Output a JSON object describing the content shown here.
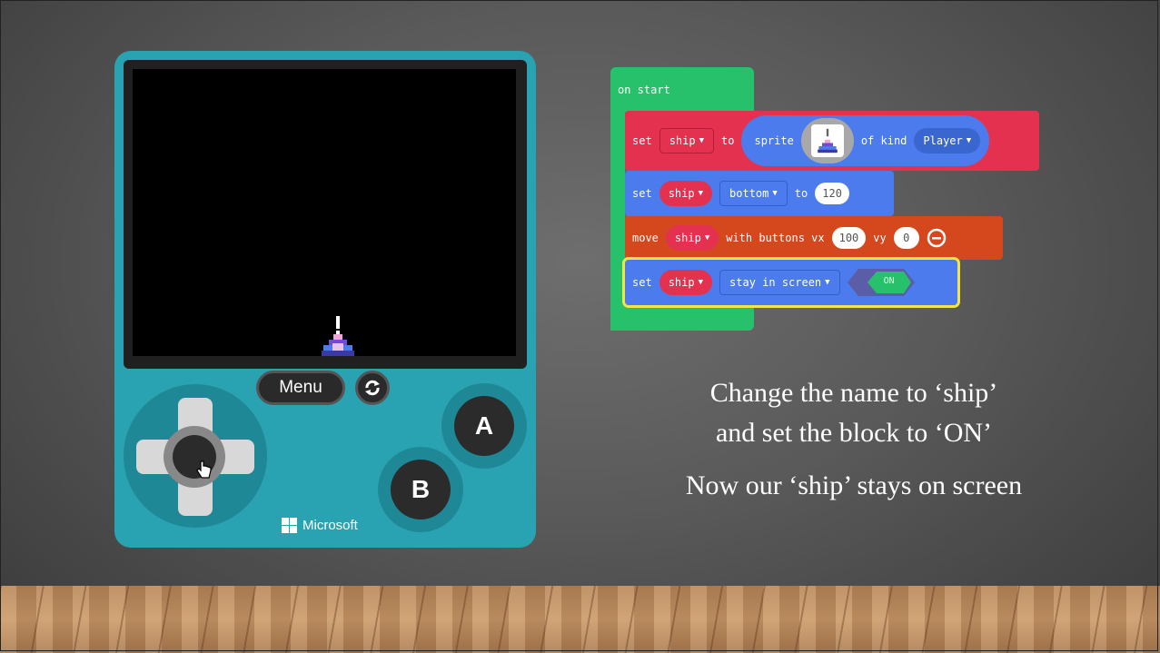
{
  "console": {
    "menu_label": "Menu",
    "button_a": "A",
    "button_b": "B",
    "brand": "Microsoft"
  },
  "blocks": {
    "on_start": "on start",
    "row1": {
      "kw_set": "set",
      "var": "ship",
      "kw_to": "to",
      "kw_sprite": "sprite",
      "kw_of_kind": "of kind",
      "kind": "Player"
    },
    "row2": {
      "kw_set": "set",
      "var": "ship",
      "prop": "bottom",
      "kw_to": "to",
      "value": "120"
    },
    "row3": {
      "kw_move": "move",
      "var": "ship",
      "kw_with": "with buttons vx",
      "vx": "100",
      "kw_vy": "vy",
      "vy": "0"
    },
    "row4": {
      "kw_set": "set",
      "var": "ship",
      "flag": "stay in screen",
      "toggle": "ON"
    }
  },
  "caption": {
    "line1": "Change the name to ‘ship’",
    "line2": "and set the block to ‘ON’",
    "line3": "Now our ‘ship’ stays on screen"
  },
  "colors": {
    "console": "#29a2b1",
    "on_start_green": "#27c06b",
    "variable_red": "#e53150",
    "sprites_blue": "#4b7bec",
    "controller_orange": "#d5481e",
    "toggle_green": "#27c06b",
    "highlight_yellow": "#f5e447"
  }
}
